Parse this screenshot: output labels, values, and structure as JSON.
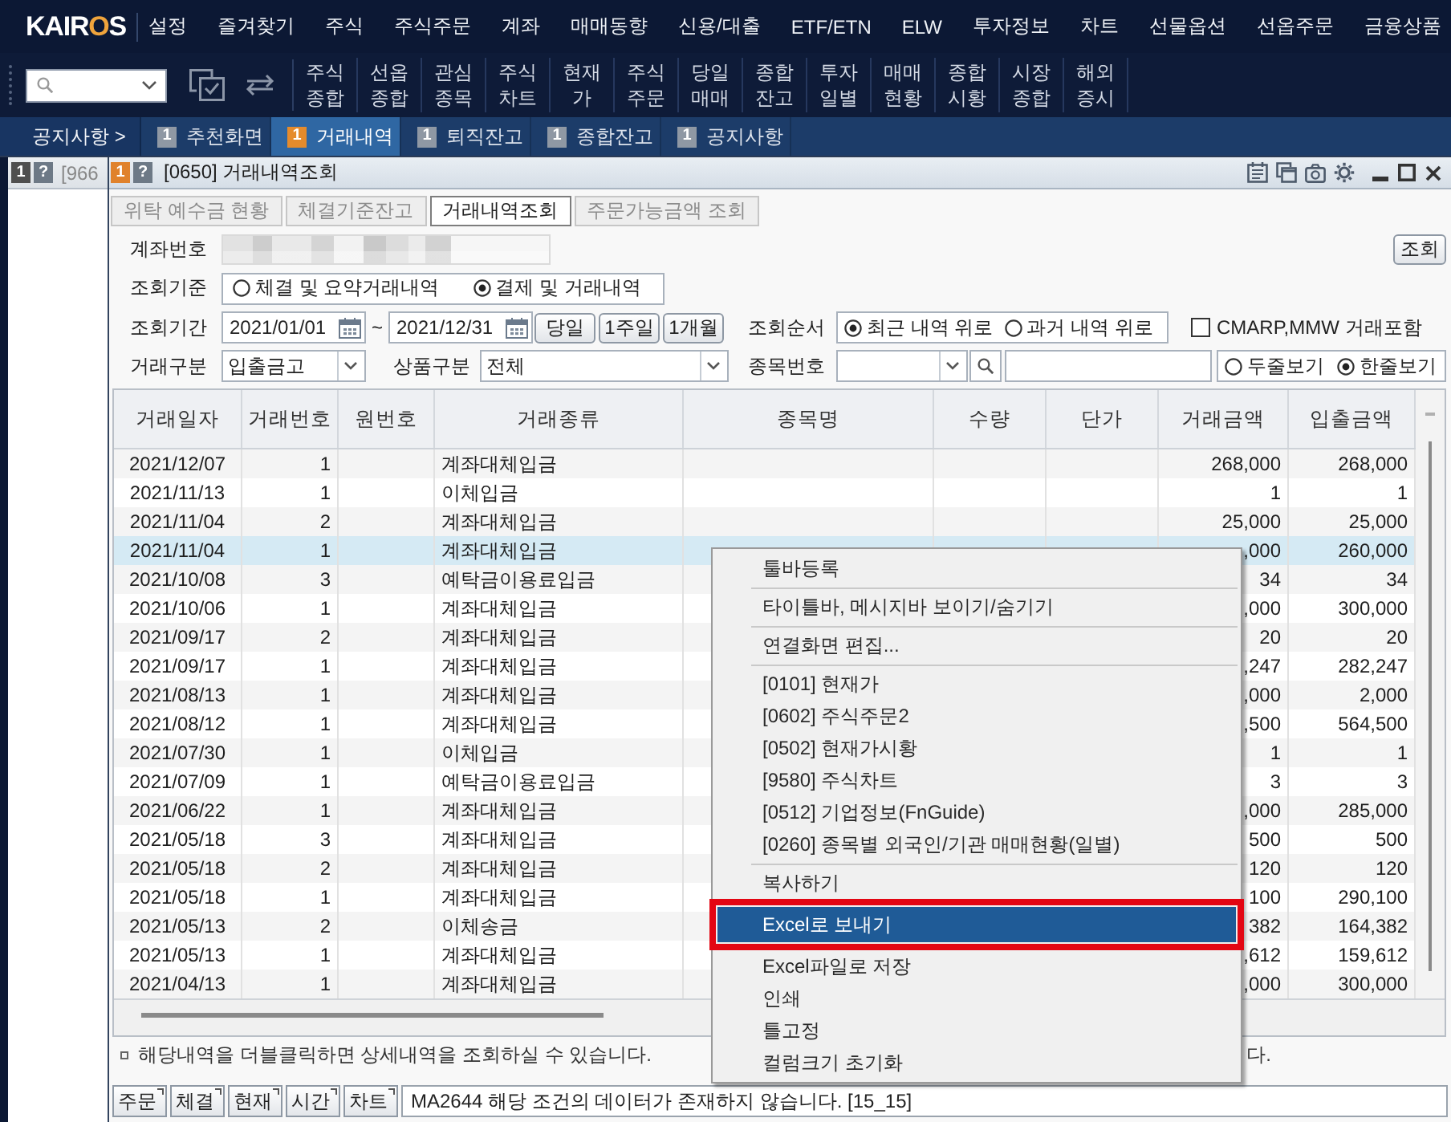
{
  "app_bar": {
    "logo": {
      "lead": "KAIR",
      "accent": "O",
      "tail": "S"
    },
    "menu": [
      "설정",
      "즐겨찾기",
      "주식",
      "주식주문",
      "계좌",
      "매매동향",
      "신용/대출",
      "ETF/ETN",
      "ELW",
      "투자정보",
      "차트",
      "선물옵션",
      "선옵주문",
      "금융상품"
    ]
  },
  "toolbar": {
    "buttons": [
      "주식 종합",
      "선옵 종합",
      "관심 종목",
      "주식 차트",
      "현재 가",
      "주식 주문",
      "당일 매매",
      "종합 잔고",
      "투자 일별",
      "매매 현황",
      "종합 시황",
      "시장 종합",
      "해외 증시"
    ]
  },
  "screen_tabs": {
    "lead": "공지사항 >",
    "tabs": [
      {
        "badge": "1",
        "label": "추천화면",
        "selected": false
      },
      {
        "badge": "1",
        "label": "거래내역",
        "selected": true
      },
      {
        "badge": "1",
        "label": "퇴직잔고",
        "selected": false
      },
      {
        "badge": "1",
        "label": "종합잔고",
        "selected": false
      },
      {
        "badge": "1",
        "label": "공지사항",
        "selected": false
      }
    ]
  },
  "side_window": {
    "active": false,
    "badges": [
      {
        "kind": "number",
        "text": "1"
      },
      {
        "kind": "help",
        "text": "?"
      }
    ],
    "title": "[966"
  },
  "window": {
    "active": true,
    "badges": [
      {
        "kind": "number",
        "text": "1"
      },
      {
        "kind": "help",
        "text": "?"
      }
    ],
    "title": "[0650] 거래내역조회"
  },
  "inner_tabs": [
    {
      "label": "위탁 예수금 현황",
      "selected": false
    },
    {
      "label": "체결기준잔고",
      "selected": false
    },
    {
      "label": "거래내역조회",
      "selected": true
    },
    {
      "label": "주문가능금액 조회",
      "selected": false
    }
  ],
  "form": {
    "account": {
      "label": "계좌번호"
    },
    "query_button": "조회",
    "basis": {
      "label": "조회기준",
      "options": [
        {
          "label": "체결 및 요약거래내역",
          "selected": false
        },
        {
          "label": "결제 및 거래내역",
          "selected": true
        }
      ]
    },
    "period": {
      "label": "조회기간",
      "from": "2021/01/01",
      "separator": "~",
      "to": "2021/12/31",
      "presets": [
        "당일",
        "1주일",
        "1개월"
      ]
    },
    "order": {
      "label": "조회순서",
      "options": [
        {
          "label": "최근 내역 위로",
          "selected": true
        },
        {
          "label": "과거 내역 위로",
          "selected": false
        }
      ]
    },
    "include_cmarp": {
      "label": "CMARP,MMW 거래포함",
      "checked": false
    },
    "trade_type": {
      "label": "거래구분",
      "value": "입출금고"
    },
    "product_type": {
      "label": "상품구분",
      "value": "전체"
    },
    "stock_code": {
      "label": "종목번호"
    },
    "view_mode": {
      "options": [
        {
          "label": "두줄보기",
          "selected": false
        },
        {
          "label": "한줄보기",
          "selected": true
        }
      ]
    }
  },
  "table": {
    "columns": [
      "거래일자",
      "거래번호",
      "원번호",
      "거래종류",
      "종목명",
      "수량",
      "단가",
      "거래금액",
      "입출금액"
    ],
    "rows": [
      {
        "date": "2021/12/07",
        "number": "1",
        "type": "계좌대체입금",
        "amount": "268,000",
        "net_amount": "268,000",
        "selected": false
      },
      {
        "date": "2021/11/13",
        "number": "1",
        "type": "이체입금",
        "amount": "1",
        "net_amount": "1",
        "selected": false
      },
      {
        "date": "2021/11/04",
        "number": "2",
        "type": "계좌대체입금",
        "amount": "25,000",
        "net_amount": "25,000",
        "selected": false
      },
      {
        "date": "2021/11/04",
        "number": "1",
        "type": "계좌대체입금",
        "amount": ",000",
        "net_amount": "260,000",
        "selected": true
      },
      {
        "date": "2021/10/08",
        "number": "3",
        "type": "예탁금이용료입금",
        "amount": "34",
        "net_amount": "34",
        "selected": false
      },
      {
        "date": "2021/10/06",
        "number": "1",
        "type": "계좌대체입금",
        "amount": ",000",
        "net_amount": "300,000",
        "selected": false
      },
      {
        "date": "2021/09/17",
        "number": "2",
        "type": "계좌대체입금",
        "amount": "20",
        "net_amount": "20",
        "selected": false
      },
      {
        "date": "2021/09/17",
        "number": "1",
        "type": "계좌대체입금",
        "amount": ",247",
        "net_amount": "282,247",
        "selected": false
      },
      {
        "date": "2021/08/13",
        "number": "1",
        "type": "계좌대체입금",
        "amount": ",000",
        "net_amount": "2,000",
        "selected": false
      },
      {
        "date": "2021/08/12",
        "number": "1",
        "type": "계좌대체입금",
        "amount": ",500",
        "net_amount": "564,500",
        "selected": false
      },
      {
        "date": "2021/07/30",
        "number": "1",
        "type": "이체입금",
        "amount": "1",
        "net_amount": "1",
        "selected": false
      },
      {
        "date": "2021/07/09",
        "number": "1",
        "type": "예탁금이용료입금",
        "amount": "3",
        "net_amount": "3",
        "selected": false
      },
      {
        "date": "2021/06/22",
        "number": "1",
        "type": "계좌대체입금",
        "amount": ",000",
        "net_amount": "285,000",
        "selected": false
      },
      {
        "date": "2021/05/18",
        "number": "3",
        "type": "계좌대체입금",
        "amount": "500",
        "net_amount": "500",
        "selected": false
      },
      {
        "date": "2021/05/18",
        "number": "2",
        "type": "계좌대체입금",
        "amount": "120",
        "net_amount": "120",
        "selected": false
      },
      {
        "date": "2021/05/18",
        "number": "1",
        "type": "계좌대체입금",
        "amount": "100",
        "net_amount": "290,100",
        "selected": false
      },
      {
        "date": "2021/05/13",
        "number": "2",
        "type": "이체송금",
        "amount": "382",
        "net_amount": "164,382",
        "selected": false
      },
      {
        "date": "2021/05/13",
        "number": "1",
        "type": "계좌대체입금",
        "amount": ",612",
        "net_amount": "159,612",
        "selected": false
      },
      {
        "date": "2021/04/13",
        "number": "1",
        "type": "계좌대체입금",
        "amount": ",000",
        "net_amount": "300,000",
        "selected": false
      }
    ]
  },
  "note": {
    "text": "해당내역을 더블클릭하면 상세내역을 조회하실 수 있습니다.",
    "fragment": "다."
  },
  "status_bar": {
    "buttons": [
      "주문",
      "체결",
      "현재",
      "시간",
      "차트"
    ],
    "message": "MA2644 해당 조건의 데이터가 존재하지 않습니다. [15_15]"
  },
  "context_menu": {
    "items": [
      {
        "kind": "item",
        "label": "툴바등록",
        "selected": false,
        "marked": false
      },
      {
        "kind": "separator"
      },
      {
        "kind": "item",
        "label": "타이틀바, 메시지바 보이기/숨기기",
        "selected": false,
        "marked": false
      },
      {
        "kind": "separator"
      },
      {
        "kind": "item",
        "label": "연결화면 편집...",
        "selected": false,
        "marked": false
      },
      {
        "kind": "separator"
      },
      {
        "kind": "item",
        "label": "[0101] 현재가",
        "selected": false,
        "marked": false
      },
      {
        "kind": "item",
        "label": "[0602] 주식주문2",
        "selected": false,
        "marked": false
      },
      {
        "kind": "item",
        "label": "[0502] 현재가시황",
        "selected": false,
        "marked": false
      },
      {
        "kind": "item",
        "label": "[9580] 주식차트",
        "selected": false,
        "marked": false
      },
      {
        "kind": "item",
        "label": "[0512] 기업정보(FnGuide)",
        "selected": false,
        "marked": false
      },
      {
        "kind": "item",
        "label": "[0260] 종목별 외국인/기관 매매현황(일별)",
        "selected": false,
        "marked": false
      },
      {
        "kind": "separator"
      },
      {
        "kind": "item",
        "label": "복사하기",
        "selected": false,
        "marked": false
      },
      {
        "kind": "item",
        "label": "Excel로 보내기",
        "selected": true,
        "marked": true
      },
      {
        "kind": "item",
        "label": "Excel파일로 저장",
        "selected": false,
        "marked": false
      },
      {
        "kind": "item",
        "label": "인쇄",
        "selected": false,
        "marked": false
      },
      {
        "kind": "item",
        "label": "틀고정",
        "selected": false,
        "marked": false
      },
      {
        "kind": "item",
        "label": "컬럼크기 초기화",
        "selected": false,
        "marked": false
      }
    ]
  }
}
